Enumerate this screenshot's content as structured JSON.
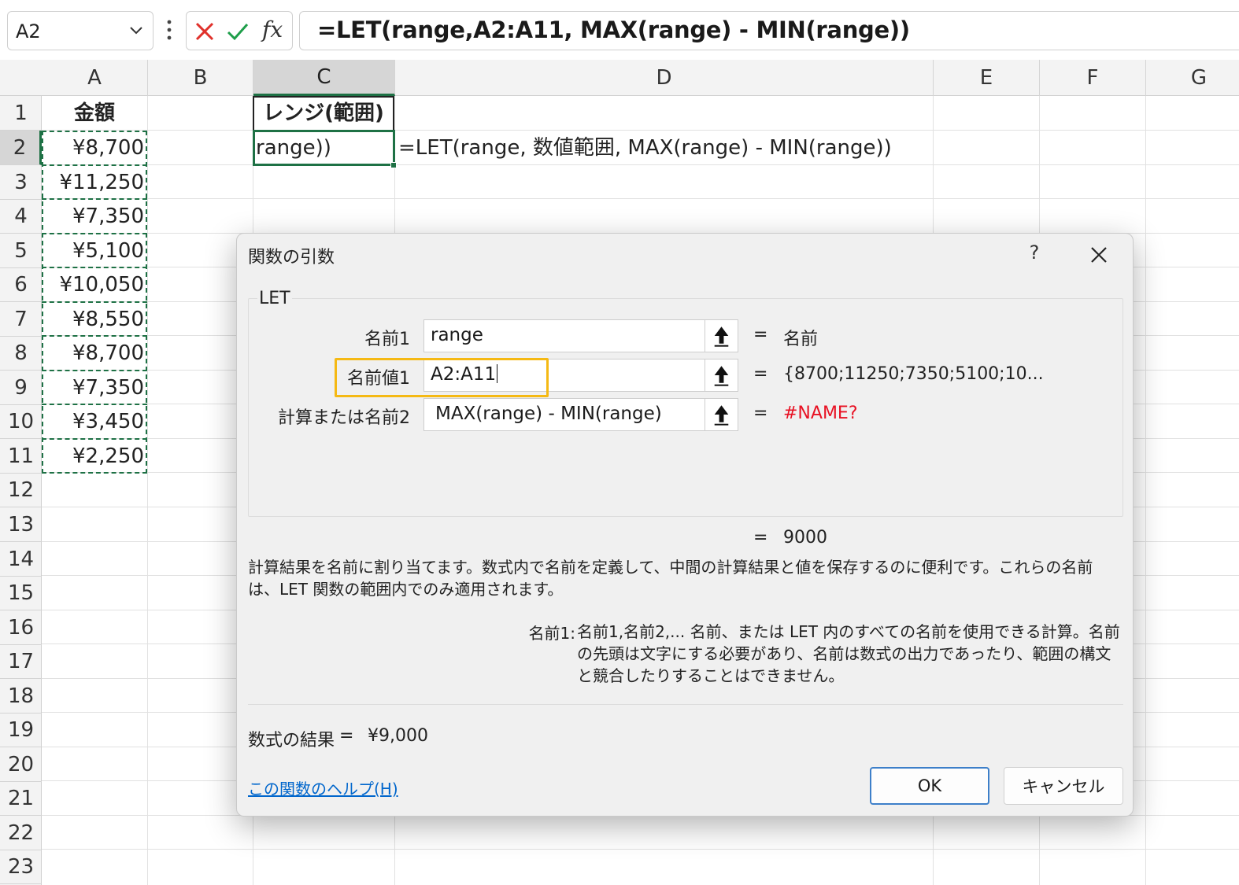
{
  "formula_bar": {
    "name_box": "A2",
    "cancel_icon": "cancel-x-icon",
    "enter_icon": "enter-check-icon",
    "fx_label": "fx",
    "formula": "=LET(range,A2:A11, MAX(range) - MIN(range))"
  },
  "columns": [
    "A",
    "B",
    "C",
    "D",
    "E",
    "F",
    "G"
  ],
  "rows": [
    "1",
    "2",
    "3",
    "4",
    "5",
    "6",
    "7",
    "8",
    "9",
    "10",
    "11",
    "12",
    "13",
    "14",
    "15",
    "16",
    "17",
    "18",
    "19",
    "20",
    "21",
    "22",
    "23"
  ],
  "sheet": {
    "a1": "金額",
    "amounts": [
      "¥8,700",
      "¥11,250",
      "¥7,350",
      "¥5,100",
      "¥10,050",
      "¥8,550",
      "¥8,700",
      "¥7,350",
      "¥3,450",
      "¥2,250"
    ],
    "c1": "レンジ(範囲)",
    "c2": "range))",
    "d2": "=LET(range, 数値範囲, MAX(range) - MIN(range))"
  },
  "dialog": {
    "title": "関数の引数",
    "help": "?",
    "function_name": "LET",
    "args": [
      {
        "label": "名前1",
        "value": "range",
        "eq": "=",
        "result": "名前",
        "error": false
      },
      {
        "label": "名前値1",
        "value": "A2:A11",
        "eq": "=",
        "result": "{8700;11250;7350;5100;10...",
        "error": false
      },
      {
        "label": "計算または名前2",
        "value": "MAX(range) - MIN(range)",
        "eq": "=",
        "result": "#NAME?",
        "error": true
      }
    ],
    "total_eq": "=",
    "total_value": "9000",
    "description": "計算結果を名前に割り当てます。数式内で名前を定義して、中間の計算結果と値を保存するのに便利です。これらの名前は、LET 関数の範囲内でのみ適用されます。",
    "arg_desc_name": "名前1:",
    "arg_desc_text": "名前1,名前2,... 名前、または LET 内のすべての名前を使用できる計算。名前の先頭は文字にする必要があり、名前は数式の出力であったり、範囲の構文と競合したりすることはできません。",
    "result_label": "数式の結果",
    "result_eq": "=",
    "result_value": "¥9,000",
    "help_link": "この関数のヘルプ(H)",
    "ok": "OK",
    "cancel": "キャンセル"
  },
  "colors": {
    "accent_green": "#1e7145",
    "highlight": "#f5b914",
    "error": "#e81123",
    "link": "#0066cc"
  }
}
